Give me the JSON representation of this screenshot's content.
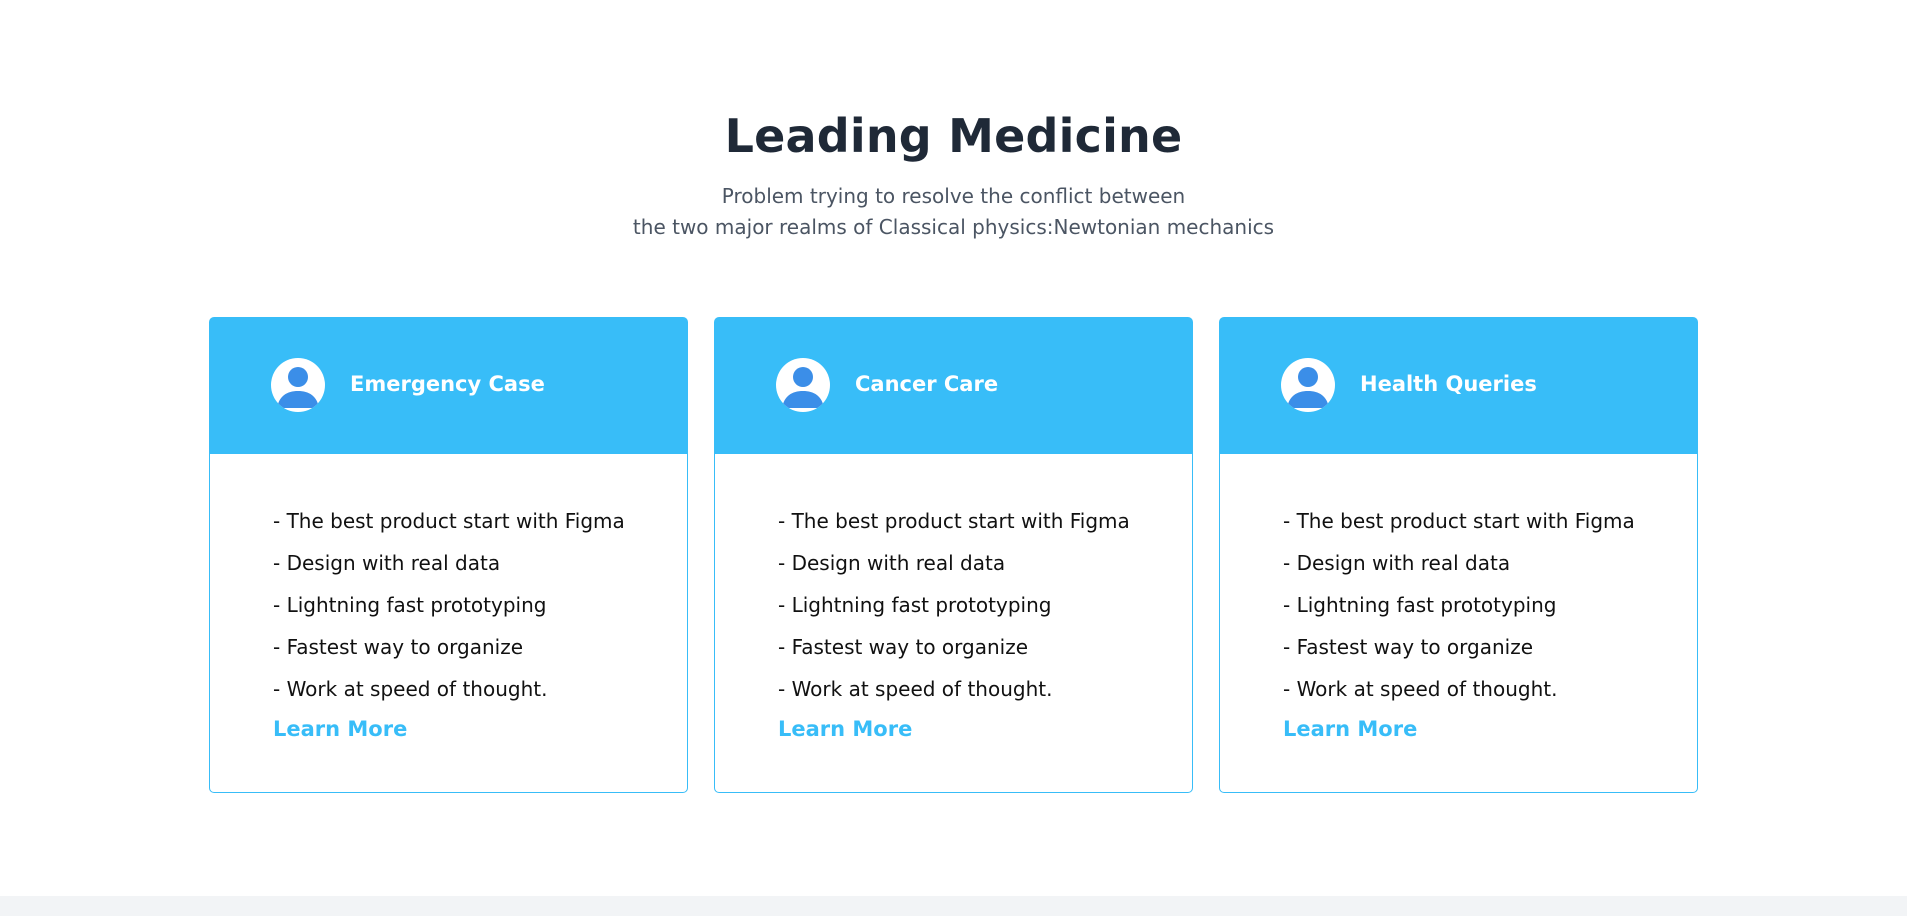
{
  "section": {
    "title": "Leading Medicine",
    "subtitle_line1": "Problem trying to resolve the conflict between",
    "subtitle_line2": "the two major realms of Classical physics:Newtonian mechanics"
  },
  "cards": [
    {
      "title": "Emergency Case",
      "icon": "user-avatar-icon",
      "features": [
        "- The best product start with Figma",
        "- Design with real data",
        "- Lightning fast prototyping",
        "- Fastest way to organize",
        "- Work at speed of thought."
      ],
      "link_label": "Learn More"
    },
    {
      "title": "Cancer Care",
      "icon": "user-avatar-icon",
      "features": [
        "- The best product start with Figma",
        "- Design with real data",
        "- Lightning fast prototyping",
        "- Fastest way to organize",
        "- Work at speed of thought."
      ],
      "link_label": "Learn More"
    },
    {
      "title": "Health Queries",
      "icon": "user-avatar-icon",
      "features": [
        "- The best product start with Figma",
        "- Design with real data",
        "- Lightning fast prototyping",
        "- Fastest way to organize",
        "- Work at speed of thought."
      ],
      "link_label": "Learn More"
    }
  ],
  "colors": {
    "accent": "#38bdf8",
    "heading": "#1f2937",
    "subtitle": "#4b5563",
    "avatar_figure": "#3b8ee8",
    "footer_strip": "#f2f4f6"
  }
}
